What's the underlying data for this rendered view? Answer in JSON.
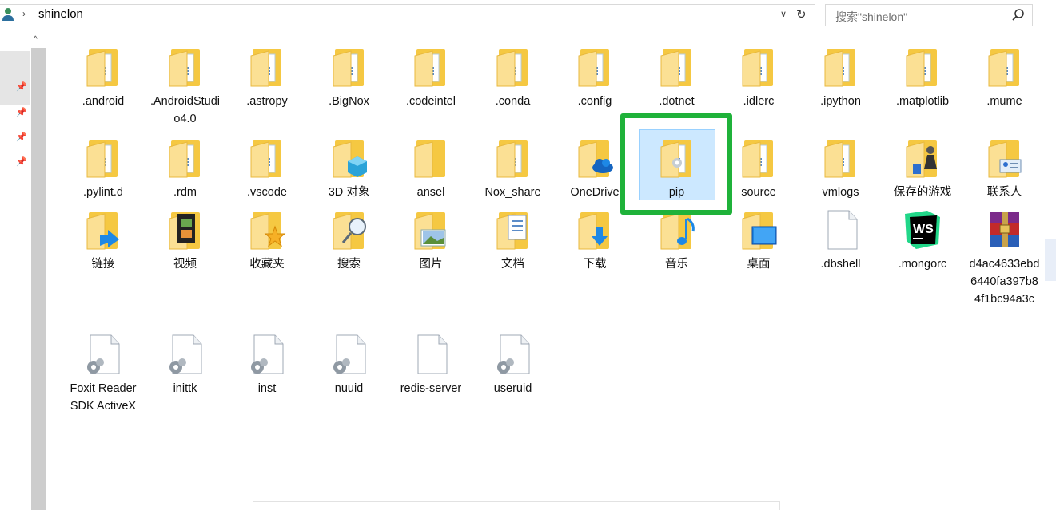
{
  "address": {
    "breadcrumb_separator": "›",
    "breadcrumb": "shinelon",
    "dropdown_glyph": "∨",
    "refresh_glyph": "↻",
    "search_placeholder": "搜索\"shinelon\""
  },
  "nav": {
    "scroll_up_glyph": "^",
    "pin_glyph": "📌"
  },
  "items": [
    {
      "label": ".android",
      "icon": "folder-doc"
    },
    {
      "label": ".AndroidStudio4.0",
      "icon": "folder-doc"
    },
    {
      "label": ".astropy",
      "icon": "folder-doc"
    },
    {
      "label": ".BigNox",
      "icon": "folder-doc"
    },
    {
      "label": ".codeintel",
      "icon": "folder-doc"
    },
    {
      "label": ".conda",
      "icon": "folder-doc"
    },
    {
      "label": ".config",
      "icon": "folder-doc"
    },
    {
      "label": ".dotnet",
      "icon": "folder-doc"
    },
    {
      "label": ".idlerc",
      "icon": "folder-doc"
    },
    {
      "label": ".ipython",
      "icon": "folder-doc"
    },
    {
      "label": ".matplotlib",
      "icon": "folder-doc"
    },
    {
      "label": ".mume",
      "icon": "folder-doc"
    },
    {
      "label": ".pylint.d",
      "icon": "folder-doc"
    },
    {
      "label": ".rdm",
      "icon": "folder-doc"
    },
    {
      "label": ".vscode",
      "icon": "folder-doc"
    },
    {
      "label": "3D 对象",
      "icon": "folder-3d"
    },
    {
      "label": "ansel",
      "icon": "folder"
    },
    {
      "label": "Nox_share",
      "icon": "folder-doc"
    },
    {
      "label": "OneDrive",
      "icon": "folder-cloud"
    },
    {
      "label": "pip",
      "icon": "folder-gear",
      "selected": true
    },
    {
      "label": "source",
      "icon": "folder-doc"
    },
    {
      "label": "vmlogs",
      "icon": "folder-doc"
    },
    {
      "label": "保存的游戏",
      "icon": "folder-game"
    },
    {
      "label": "联系人",
      "icon": "folder-contact"
    },
    {
      "label": "链接",
      "icon": "folder-link"
    },
    {
      "label": "视频",
      "icon": "folder-video"
    },
    {
      "label": "收藏夹",
      "icon": "folder-star"
    },
    {
      "label": "搜索",
      "icon": "folder-search"
    },
    {
      "label": "图片",
      "icon": "folder-picture"
    },
    {
      "label": "文档",
      "icon": "folder-document"
    },
    {
      "label": "下载",
      "icon": "folder-download"
    },
    {
      "label": "音乐",
      "icon": "folder-music"
    },
    {
      "label": "桌面",
      "icon": "folder-desktop"
    },
    {
      "label": ".dbshell",
      "icon": "file"
    },
    {
      "label": ".mongorc",
      "icon": "webstorm"
    },
    {
      "label": "d4ac4633ebd6440fa397b84f1bc94a3c",
      "icon": "winrar"
    },
    {
      "label": "Foxit Reader SDK ActiveX",
      "icon": "file-gear"
    },
    {
      "label": "inittk",
      "icon": "file-gear"
    },
    {
      "label": "inst",
      "icon": "file-gear"
    },
    {
      "label": "nuuid",
      "icon": "file-gear"
    },
    {
      "label": "redis-server",
      "icon": "file"
    },
    {
      "label": "useruid",
      "icon": "file-gear"
    }
  ],
  "colors": {
    "selection_fill": "#cce8ff",
    "selection_border": "#99d1ff",
    "highlight_frame": "#1fb23a",
    "folder_yellow": "#f5c842"
  }
}
